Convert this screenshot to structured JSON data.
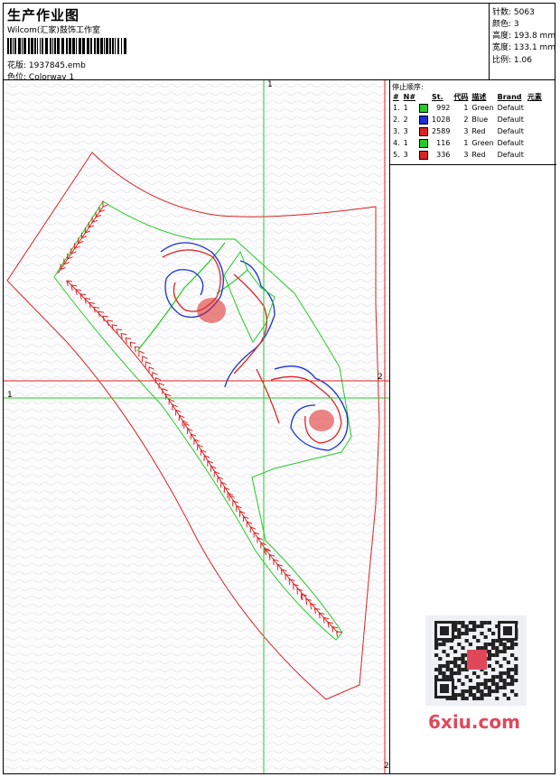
{
  "header": {
    "title": "生产作业图",
    "subtitle": "Wilcom(汇家)鼓饰工作室",
    "file_label": "花版:",
    "file_value": "1937845.emb",
    "color_label": "色位:",
    "color_value": "Colorway 1"
  },
  "stats": [
    {
      "label": "针数:",
      "value": "5063"
    },
    {
      "label": "颜色:",
      "value": "3"
    },
    {
      "label": "高度:",
      "value": "193.8 mm"
    },
    {
      "label": "宽度:",
      "value": "133.1 mm"
    },
    {
      "label": "比例:",
      "value": "1.06"
    }
  ],
  "stop_sequence": {
    "title": "停止顺序:",
    "columns": [
      "#",
      "N#",
      "St.",
      "代码",
      "描述",
      "Brand",
      "元素"
    ],
    "rows": [
      {
        "num": "1.",
        "n": "1",
        "color": "#22cc22",
        "st": "992",
        "code": "1",
        "desc": "Green",
        "brand": "Default"
      },
      {
        "num": "2.",
        "n": "2",
        "color": "#1a2fd6",
        "st": "1028",
        "code": "2",
        "desc": "Blue",
        "brand": "Default"
      },
      {
        "num": "3.",
        "n": "3",
        "color": "#dd2222",
        "st": "2589",
        "code": "3",
        "desc": "Red",
        "brand": "Default"
      },
      {
        "num": "4.",
        "n": "1",
        "color": "#22cc22",
        "st": "116",
        "code": "1",
        "desc": "Green",
        "brand": "Default"
      },
      {
        "num": "5.",
        "n": "3",
        "color": "#dd2222",
        "st": "336",
        "code": "3",
        "desc": "Red",
        "brand": "Default"
      }
    ]
  },
  "canvas": {
    "axis_labels": {
      "top": "1",
      "left": "1",
      "right": "2",
      "bottom": "2"
    }
  },
  "watermark": "6xiu.com",
  "colors": {
    "green": "#22cc22",
    "blue": "#1a2fd6",
    "red": "#dd2222"
  }
}
